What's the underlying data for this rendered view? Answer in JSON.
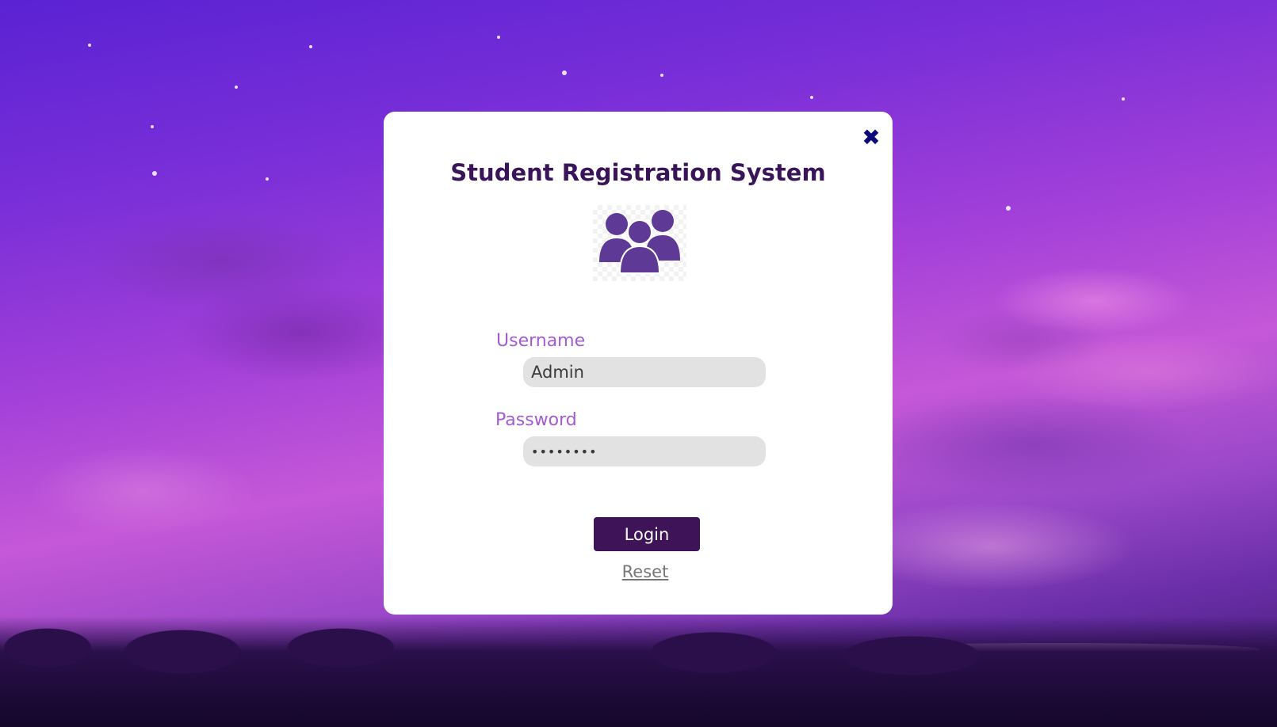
{
  "dialog": {
    "title": "Student Registration System",
    "close_icon": "close-icon",
    "close_glyph": "✖",
    "logo_icon": "users-group-icon",
    "username": {
      "label": "Username",
      "value": "Admin"
    },
    "password": {
      "label": "Password",
      "value": "••••••••"
    },
    "login_label": "Login",
    "reset_label": "Reset"
  },
  "colors": {
    "title": "#3a1458",
    "label": "#a35bd4",
    "login_button": "#3f1358",
    "close_icon": "#0b0b7a",
    "logo": "#5e3a96",
    "input_bg": "#e2e2e2"
  }
}
